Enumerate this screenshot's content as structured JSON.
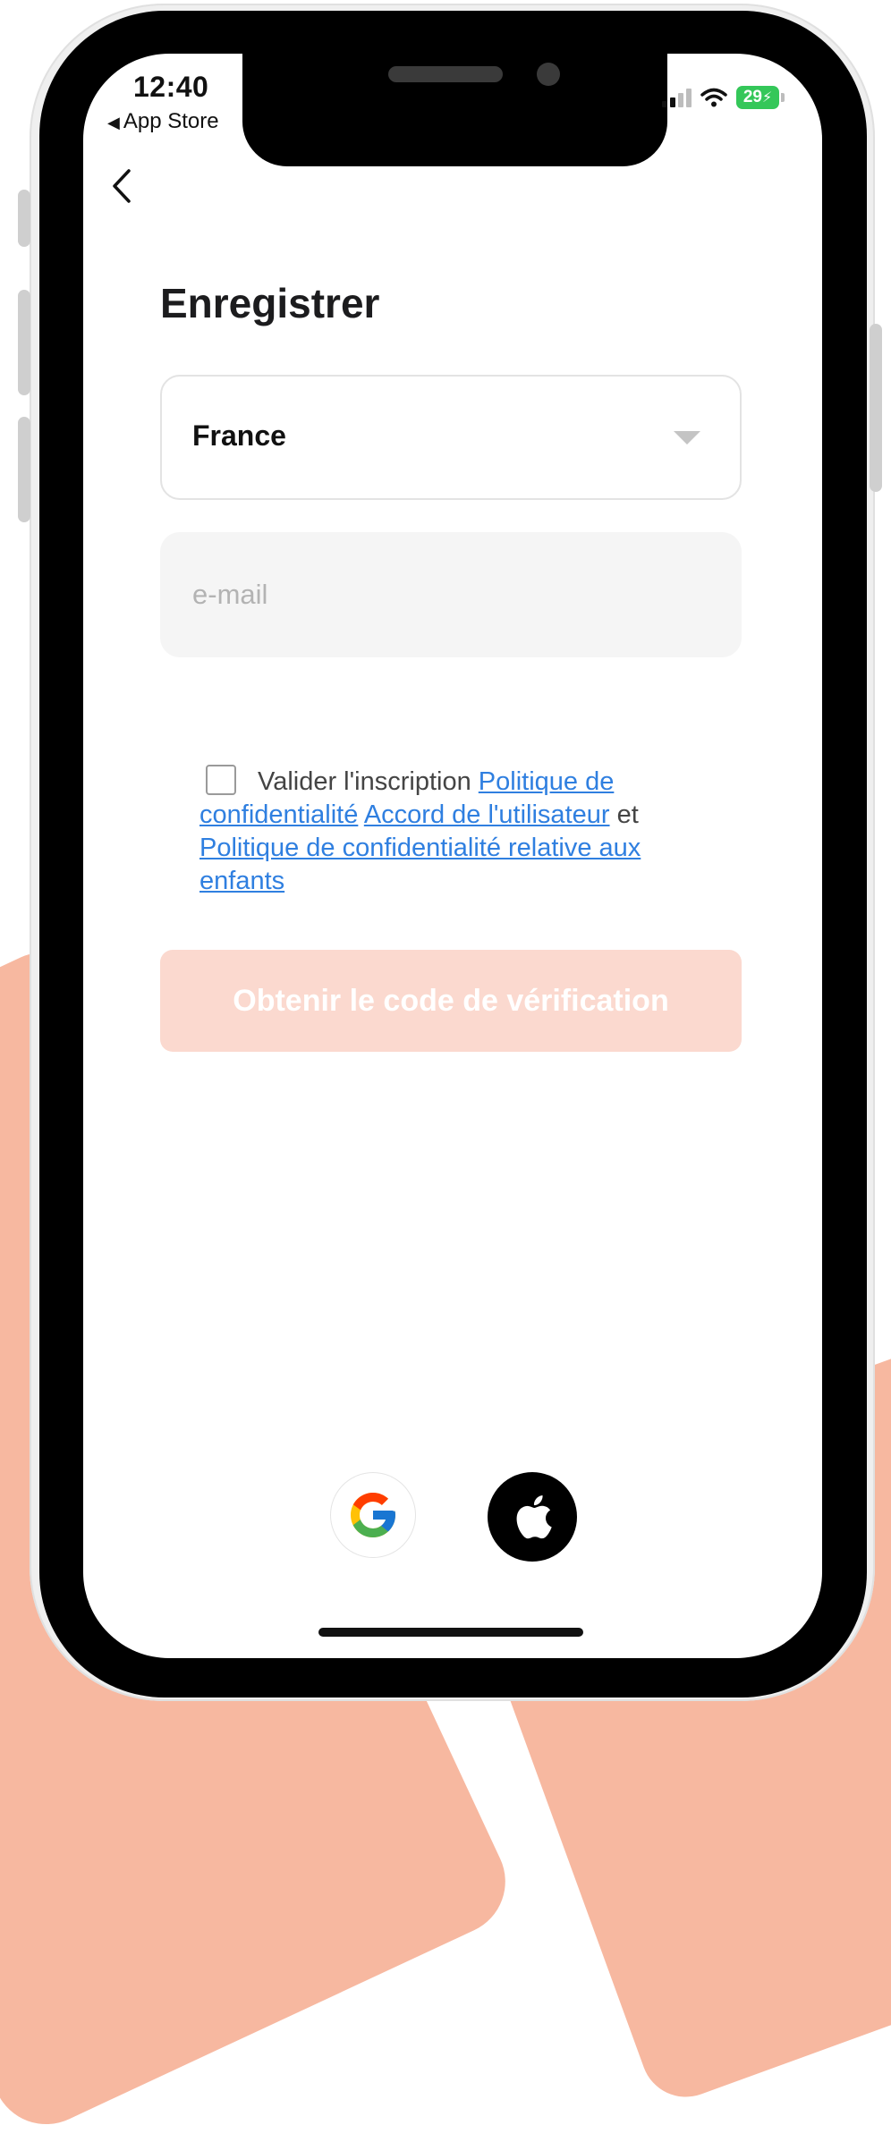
{
  "status_bar": {
    "time": "12:40",
    "back_app": "App Store",
    "battery": "29"
  },
  "header": {
    "title": "Enregistrer"
  },
  "form": {
    "country": "France",
    "email_placeholder": "e-mail"
  },
  "terms": {
    "prefix": "Valider l'inscription",
    "link_privacy": "Politique de confidentialité",
    "link_user_agreement": "Accord de l'utilisateur",
    "conjunction": "et",
    "link_children_privacy": "Politique de confidentialité relative aux enfants",
    "checked": false
  },
  "actions": {
    "primary_label": "Obtenir le code de vérification"
  },
  "social": {
    "google_icon": "google-logo-icon",
    "apple_icon": "apple-logo-icon"
  },
  "colors": {
    "accent_background": "#f7b8a0",
    "primary_button_disabled": "#fbd9cf",
    "link": "#2f7fe0",
    "battery_green": "#34c759"
  }
}
